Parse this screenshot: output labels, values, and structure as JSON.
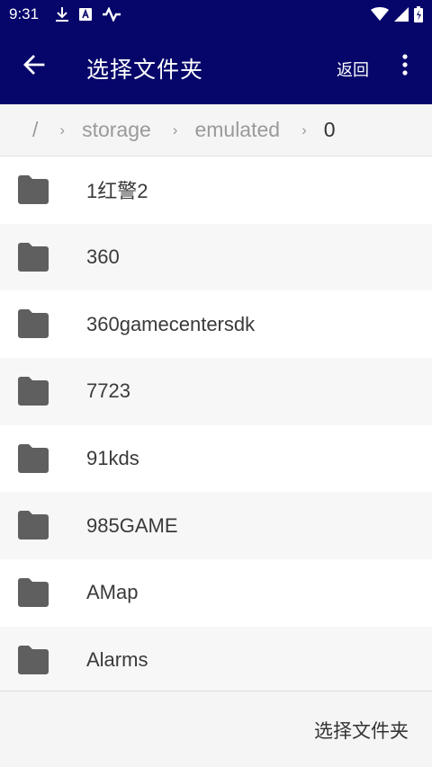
{
  "status_bar": {
    "time": "9:31",
    "left_icons": [
      "download-icon",
      "a-box-icon",
      "activity-icon"
    ],
    "right_icons": [
      "wifi-icon",
      "signal-icon",
      "battery-charging-icon"
    ]
  },
  "app_bar": {
    "title": "选择文件夹",
    "back_label": "返回",
    "background": "#05056a"
  },
  "breadcrumb": {
    "root": "/",
    "segments": [
      "storage",
      "emulated",
      "0"
    ]
  },
  "folders": [
    {
      "name": "1红警2"
    },
    {
      "name": "360"
    },
    {
      "name": "360gamecentersdk"
    },
    {
      "name": "7723"
    },
    {
      "name": "91kds"
    },
    {
      "name": "985GAME"
    },
    {
      "name": "AMap"
    },
    {
      "name": "Alarms"
    }
  ],
  "bottom": {
    "select_label": "选择文件夹"
  },
  "colors": {
    "accent": "#05056a",
    "folder_icon": "#5f5f5f"
  }
}
